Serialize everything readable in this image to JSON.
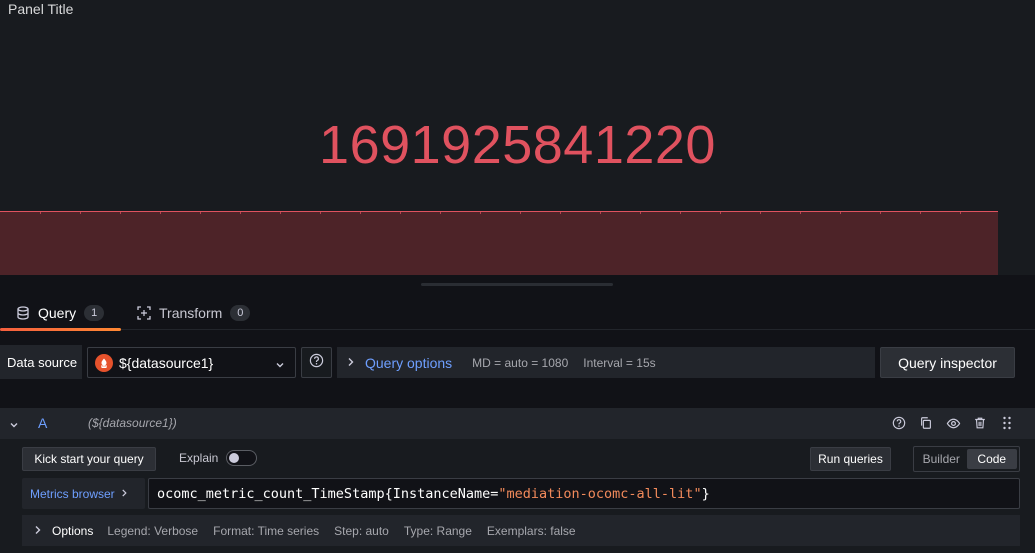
{
  "panel": {
    "title": "Panel Title",
    "value": "1691925841220",
    "value_color": "#e0525f"
  },
  "tabs": [
    {
      "label": "Query",
      "count": "1",
      "icon": "database-icon"
    },
    {
      "label": "Transform",
      "count": "0",
      "icon": "transform-icon"
    }
  ],
  "datasource": {
    "label": "Data source",
    "selected": "${datasource1}",
    "logo": "prometheus-icon"
  },
  "query_options": {
    "title": "Query options",
    "md": "MD = auto = 1080",
    "interval": "Interval = 15s"
  },
  "query_inspector_label": "Query inspector",
  "query_a": {
    "letter": "A",
    "datasource": "(${datasource1})",
    "kick_start": "Kick start your query",
    "explain": "Explain",
    "run_queries": "Run queries",
    "mode_builder": "Builder",
    "mode_code": "Code",
    "metrics_browser": "Metrics browser",
    "expr_metric": "ocomc_metric_count_TimeStamp{InstanceName=",
    "expr_value": "\"mediation-ocomc-all-lit\"",
    "expr_close": "}"
  },
  "options": {
    "title": "Options",
    "legend": "Legend: Verbose",
    "format": "Format: Time series",
    "step": "Step: auto",
    "type": "Type: Range",
    "exemplars": "Exemplars: false"
  },
  "colors": {
    "accent": "#6e9fff",
    "tab_underline": "#f55f3e",
    "string_literal": "#f28a5b"
  }
}
